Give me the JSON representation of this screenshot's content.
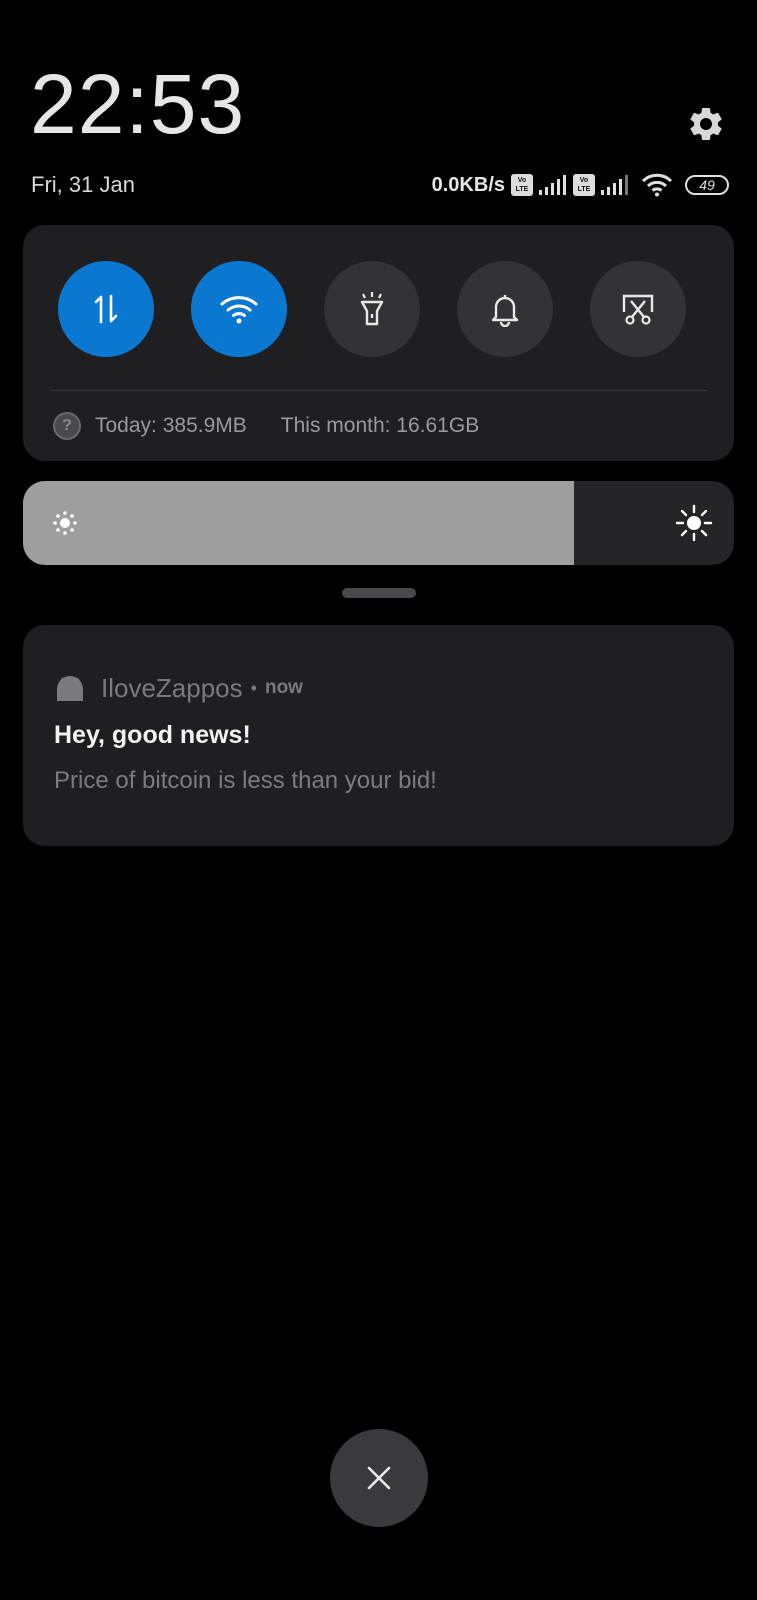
{
  "header": {
    "time": "22:53",
    "date": "Fri, 31 Jan",
    "network_speed": "0.0KB/s",
    "sim1_label_top": "Vo",
    "sim1_label_bottom": "LTE",
    "sim2_label_top": "Vo",
    "sim2_label_bottom": "LTE",
    "battery_level": "49"
  },
  "quick_settings": {
    "tiles": [
      {
        "name": "mobile-data",
        "active": true
      },
      {
        "name": "wifi",
        "active": true
      },
      {
        "name": "flashlight",
        "active": false
      },
      {
        "name": "sound",
        "active": false
      },
      {
        "name": "screenshot",
        "active": false
      }
    ],
    "usage_today": "Today: 385.9MB",
    "usage_month": "This month: 16.61GB",
    "help_glyph": "?"
  },
  "brightness": {
    "level": 0.775
  },
  "notification": {
    "app_name": "IloveZappos",
    "separator": "•",
    "time": "now",
    "title": "Hey, good news!",
    "body": "Price of bitcoin is less than your bid!"
  },
  "colors": {
    "accent": "#0a78d1",
    "panel": "#1f1f21",
    "background": "#000000"
  },
  "icons": {
    "settings": "gear-icon",
    "close": "close-icon"
  }
}
